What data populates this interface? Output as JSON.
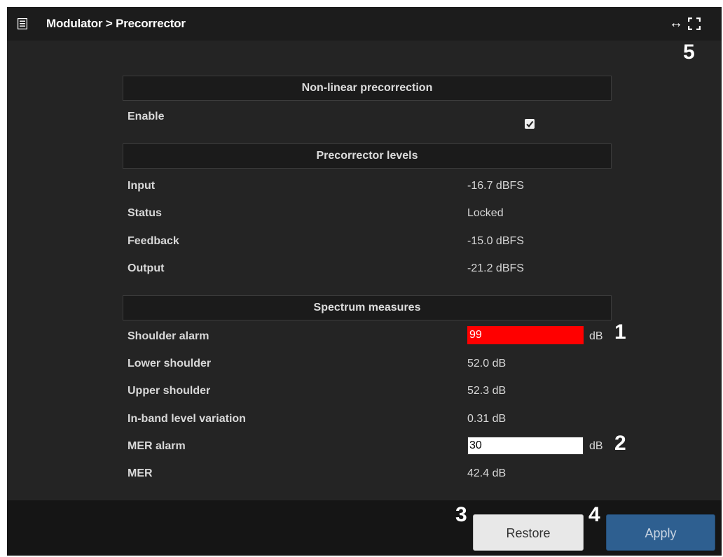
{
  "titlebar": {
    "breadcrumb": "Modulator > Precorrector",
    "icons": [
      "list-icon",
      "resize-horizontal-icon",
      "fullscreen-icon"
    ]
  },
  "callouts": [
    "1",
    "2",
    "3",
    "4",
    "5"
  ],
  "nonlinear": {
    "header": "Non-linear precorrection",
    "enable_label": "Enable",
    "enable_checked": true
  },
  "levels": {
    "header": "Precorrector levels",
    "rows": [
      {
        "label": "Input",
        "value": "-16.7 dBFS"
      },
      {
        "label": "Status",
        "value": "Locked"
      },
      {
        "label": "Feedback",
        "value": "-15.0 dBFS"
      },
      {
        "label": "Output",
        "value": "-21.2 dBFS"
      }
    ]
  },
  "spectrum": {
    "header": "Spectrum measures",
    "shoulder_alarm": {
      "label": "Shoulder alarm",
      "value": "99",
      "unit": "dB",
      "color": "#ff0000"
    },
    "lower_shoulder": {
      "label": "Lower shoulder",
      "value": "52.0 dB"
    },
    "upper_shoulder": {
      "label": "Upper shoulder",
      "value": "52.3 dB"
    },
    "inband": {
      "label": "In-band level variation",
      "value": "0.31 dB"
    },
    "mer_alarm": {
      "label": "MER alarm",
      "value": "30",
      "unit": "dB"
    },
    "mer": {
      "label": "MER",
      "value": "42.4 dB"
    }
  },
  "footer": {
    "restore_label": "Restore",
    "apply_label": "Apply",
    "apply_color": "#2e5f90"
  }
}
